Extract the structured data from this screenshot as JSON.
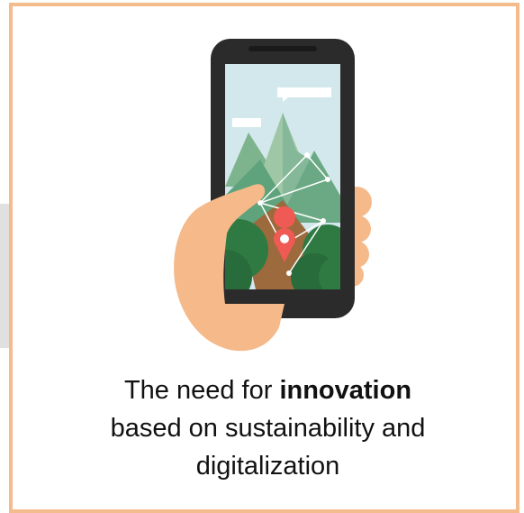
{
  "caption": {
    "line1_prefix": "The need for ",
    "line1_bold": "innovation",
    "line2": "based on sustainability and",
    "line3": "digitalization"
  },
  "colors": {
    "card_border": "#f4bb8c",
    "skin": "#f5b98a",
    "phone_body": "#2b2b2b",
    "sky": "#d3e8ec",
    "mountain_light": "#9fc7a6",
    "mountain_mid": "#5ea37b",
    "forest_dark": "#2f7a43",
    "path_brown": "#9c6a3c",
    "pin_red": "#ef5a54"
  },
  "icons": [
    "location-pin-icon",
    "smartphone-map-illustration"
  ]
}
